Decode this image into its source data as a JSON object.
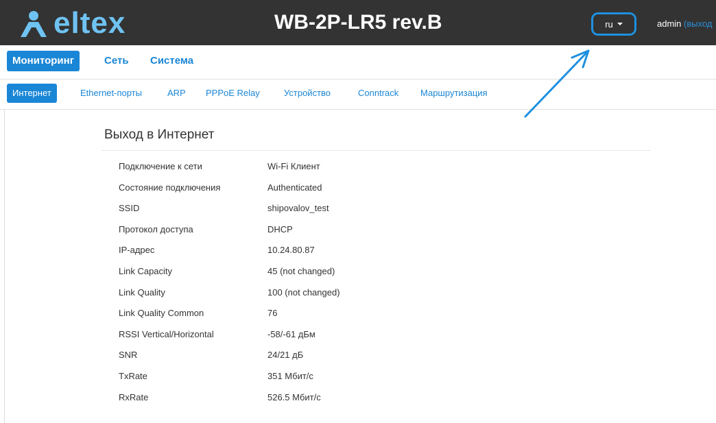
{
  "header": {
    "logo_text": "eltex",
    "device_title": "WB-2P-LR5 rev.B",
    "language": "ru",
    "user": "admin",
    "logout_label": "(выход"
  },
  "nav_main": {
    "items": [
      {
        "label": "Мониторинг",
        "active": true
      },
      {
        "label": "Сеть",
        "active": false
      },
      {
        "label": "Система",
        "active": false
      }
    ]
  },
  "nav_sub": {
    "items": [
      {
        "label": "Интернет",
        "active": true
      },
      {
        "label": "Ethernet-порты",
        "active": false
      },
      {
        "label": "ARP",
        "active": false
      },
      {
        "label": "PPPoE Relay",
        "active": false
      },
      {
        "label": "Устройство",
        "active": false
      },
      {
        "label": "Conntrack",
        "active": false
      },
      {
        "label": "Маршрутизация",
        "active": false
      }
    ]
  },
  "section": {
    "title": "Выход в Интернет",
    "rows": [
      {
        "label": "Подключение к сети",
        "value": "Wi-Fi Клиент"
      },
      {
        "label": "Состояние подключения",
        "value": "Authenticated"
      },
      {
        "label": "SSID",
        "value": "shipovalov_test"
      },
      {
        "label": "Протокол доступа",
        "value": "DHCP"
      },
      {
        "label": "IP-адрес",
        "value": "10.24.80.87"
      },
      {
        "label": "Link Capacity",
        "value": "45 (not changed)"
      },
      {
        "label": "Link Quality",
        "value": "100 (not changed)"
      },
      {
        "label": "Link Quality Common",
        "value": "76"
      },
      {
        "label": "RSSI Vertical/Horizontal",
        "value": "-58/-61 дБм"
      },
      {
        "label": "SNR",
        "value": "24/21 дБ"
      },
      {
        "label": "TxRate",
        "value": "351 Мбит/с"
      },
      {
        "label": "RxRate",
        "value": "526.5 Мбит/с"
      }
    ]
  },
  "colors": {
    "topbar": "#333333",
    "accent": "#1a86d6",
    "logo": "#6fc3f3",
    "annotation": "#1e90e0"
  }
}
